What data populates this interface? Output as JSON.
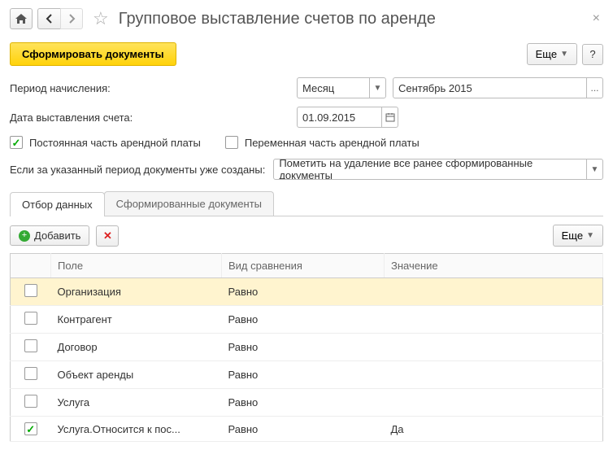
{
  "title": "Групповое выставление счетов по аренде",
  "toolbar": {
    "generate": "Сформировать документы",
    "more": "Еще"
  },
  "period": {
    "label": "Период начисления:",
    "type": "Месяц",
    "value": "Сентябрь 2015"
  },
  "invoice_date": {
    "label": "Дата выставления счета:",
    "value": "01.09.2015"
  },
  "checks": {
    "fixed": "Постоянная часть арендной платы",
    "variable": "Переменная часть арендной платы"
  },
  "existing": {
    "label": "Если за указанный период документы уже созданы:",
    "value": "Пометить на удаление все ранее сформированные документы"
  },
  "tabs": {
    "filter": "Отбор данных",
    "docs": "Сформированные документы"
  },
  "sub": {
    "add": "Добавить",
    "more": "Еще"
  },
  "cols": {
    "field": "Поле",
    "cmp": "Вид сравнения",
    "val": "Значение"
  },
  "rows": [
    {
      "checked": false,
      "field": "Организация",
      "cmp": "Равно",
      "val": ""
    },
    {
      "checked": false,
      "field": "Контрагент",
      "cmp": "Равно",
      "val": ""
    },
    {
      "checked": false,
      "field": "Договор",
      "cmp": "Равно",
      "val": ""
    },
    {
      "checked": false,
      "field": "Объект аренды",
      "cmp": "Равно",
      "val": ""
    },
    {
      "checked": false,
      "field": "Услуга",
      "cmp": "Равно",
      "val": ""
    },
    {
      "checked": true,
      "field": "Услуга.Относится к пос...",
      "cmp": "Равно",
      "val": "Да"
    }
  ]
}
